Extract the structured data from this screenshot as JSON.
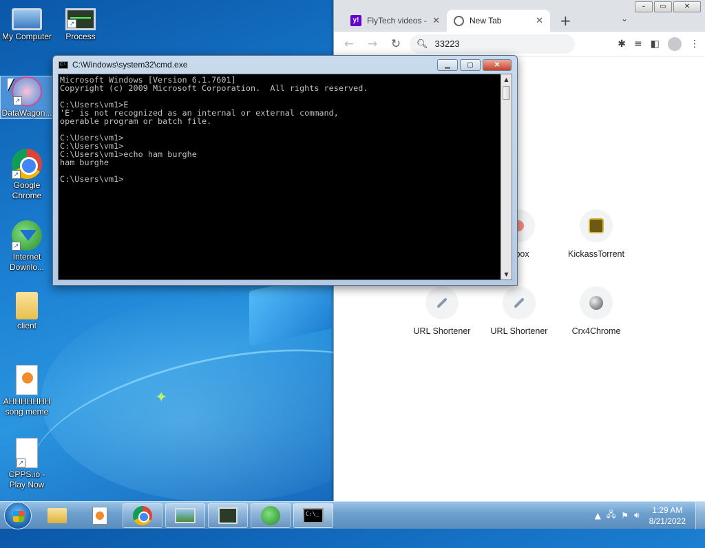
{
  "desktop": {
    "icons": [
      {
        "label": "My Computer",
        "icon": "computer-icon"
      },
      {
        "label": "Process",
        "icon": "process-monitor-icon"
      },
      {
        "label": "DataWagon...",
        "icon": "atom-icon"
      },
      {
        "label": "Google Chrome",
        "icon": "chrome-icon"
      },
      {
        "label": "Internet Downlo...",
        "icon": "internet-download-manager-icon"
      },
      {
        "label": "client",
        "icon": "folder-icon"
      },
      {
        "label": "AHHHHHHH song meme",
        "icon": "media-file-icon"
      },
      {
        "label": "CPPS.io - Play Now",
        "icon": "blank-file-icon"
      }
    ]
  },
  "chrome": {
    "tabs": [
      {
        "label": "FlyTech videos -",
        "icon": "yahoo-icon"
      },
      {
        "label": "New Tab",
        "icon": "globe-icon"
      }
    ],
    "omnibox_text": "33223",
    "shortcuts": [
      {
        "label": "erbox"
      },
      {
        "label": "KickassTorrent"
      },
      {
        "label": "URL Shortener"
      },
      {
        "label": "URL Shortener"
      },
      {
        "label": "Crx4Chrome"
      }
    ]
  },
  "cmd": {
    "title": "C:\\Windows\\system32\\cmd.exe",
    "output": "Microsoft Windows [Version 6.1.7601]\nCopyright (c) 2009 Microsoft Corporation.  All rights reserved.\n\nC:\\Users\\vm1>E\n'E' is not recognized as an internal or external command,\noperable program or batch file.\n\nC:\\Users\\vm1>\nC:\\Users\\vm1>\nC:\\Users\\vm1>echo ham burghe\nham burghe\n\nC:\\Users\\vm1>"
  },
  "taskbar": {
    "time": "1:29 AM",
    "date": "8/21/2022",
    "items": [
      "file-explorer",
      "media-player",
      "google-chrome",
      "photo-viewer",
      "process-monitor",
      "internet-download-manager",
      "command-prompt"
    ]
  },
  "colors": {
    "cmd_background": "#000000",
    "cmd_text": "#c0c0c0",
    "yahoo_purple": "#6001d2",
    "taskbar": "#6fa1cf"
  }
}
